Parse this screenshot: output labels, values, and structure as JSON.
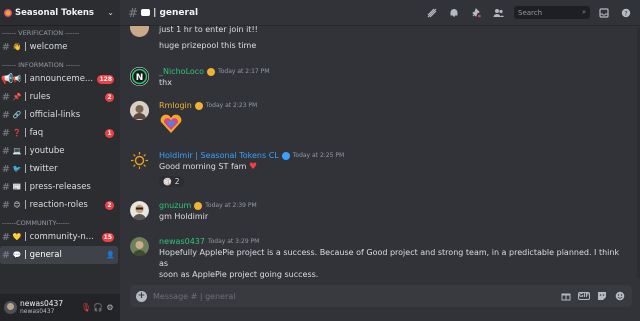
{
  "server": {
    "name": "Seasonal Tokens"
  },
  "categories": {
    "verification": "------ VERIFICATION ------",
    "information": "------ INFORMATION ------",
    "community": "------COMMUNITY------"
  },
  "channels": [
    {
      "emoji": "👋",
      "label": "| welcome",
      "badge": ""
    },
    {
      "emoji": "📢",
      "label": "| announceme...",
      "badge": "128"
    },
    {
      "emoji": "📌",
      "label": "| rules",
      "badge": "2"
    },
    {
      "emoji": "🔗",
      "label": "| official-links",
      "badge": ""
    },
    {
      "emoji": "❓",
      "label": "| faq",
      "badge": "1"
    },
    {
      "emoji": "💻",
      "label": "| youtube",
      "badge": ""
    },
    {
      "emoji": "🐦",
      "label": "| twitter",
      "badge": ""
    },
    {
      "emoji": "📰",
      "label": "| press-releases",
      "badge": ""
    },
    {
      "emoji": "😊",
      "label": "| reaction-roles",
      "badge": "2"
    },
    {
      "emoji": "💛",
      "label": "| community-n...",
      "badge": "15"
    },
    {
      "emoji": "💬",
      "label": "| general",
      "badge": ""
    }
  ],
  "user": {
    "name": "newas0437",
    "tag": "newas0437"
  },
  "topbar": {
    "title": "| general",
    "search_placeholder": "Search",
    "icons": [
      "threads-icon",
      "bell-icon",
      "pin-icon",
      "members-icon",
      "inbox-icon",
      "help-icon"
    ]
  },
  "messages": [
    {
      "author": "",
      "time": "",
      "lines": [
        "just 1 hr to enter join it!!",
        "huge prizepool this time"
      ]
    },
    {
      "author": "_NichoLoco",
      "color": "#2dc770",
      "time": "Today at 2:17 PM",
      "lines": [
        "thx"
      ]
    },
    {
      "author": "Rmlogin",
      "color": "#f0b232",
      "time": "Today at 2:23 PM",
      "lines": []
    },
    {
      "author": "Holdimir | Seasonal Tokens CL",
      "color": "#3ba0ff",
      "time": "Today at 2:25 PM",
      "lines": [
        "Good morning ST fam"
      ],
      "reaction": {
        "emoji": "🏐",
        "count": "2"
      }
    },
    {
      "author": "gnuzum",
      "color": "#2dc770",
      "time": "Today at 2:39 PM",
      "lines": [
        "gm Holdimir"
      ]
    },
    {
      "author": "newas0437",
      "color": "#2dc770",
      "time": "Today at 3:29 PM",
      "lines": [
        "Hopefully ApplePie project is a success. Because of Good project and strong team, in a predictable planned. I think as",
        "soon as ApplePie project going success."
      ]
    }
  ],
  "composer": {
    "placeholder": "Message #  | general"
  },
  "colors": {
    "bg": "#313338",
    "sidebar": "#2b2d31",
    "accent": "#5865f2",
    "badge": "#f23f43"
  }
}
